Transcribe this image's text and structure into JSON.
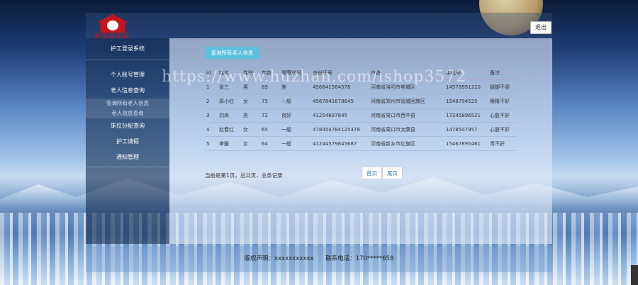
{
  "header": {
    "logo_text": "家家有家政",
    "logout_label": "退出"
  },
  "sidebar": {
    "title": "护工登录系统",
    "items": [
      {
        "label": "个人账号管理"
      },
      {
        "label": "老人信息查询"
      },
      {
        "label": "查询所有老人信息",
        "sub": true
      },
      {
        "label": "老人信息查询",
        "sub": true
      },
      {
        "label": "床位分配查询"
      },
      {
        "label": "护工请假"
      },
      {
        "label": "通知管理"
      }
    ]
  },
  "main": {
    "query_button": "查询所有老人信息",
    "columns": [
      "id",
      "姓名",
      "性别",
      "年龄",
      "健康状况",
      "身份证号",
      "户籍",
      "手机号",
      "备注"
    ],
    "rows": [
      [
        "1",
        "张三",
        "男",
        "69",
        "差",
        "456841564578",
        "河南省洛阳市老城区",
        "14578951220",
        "腿脚不便"
      ],
      [
        "2",
        "周小红",
        "女",
        "75",
        "一般",
        "4567841678645",
        "河南省郑州市管城回族区",
        "1548794525",
        "眼睛不好"
      ],
      [
        "3",
        "刘尚",
        "男",
        "72",
        "良好",
        "41254687845",
        "河南省周口市西华县",
        "17245896521",
        "心脏不好"
      ],
      [
        "4",
        "赵春红",
        "女",
        "65",
        "一般",
        "478454784125478",
        "河南省周口市太康县",
        "1478547957",
        "心脏不好"
      ],
      [
        "5",
        "李媛",
        "女",
        "64",
        "一般",
        "41244579845687",
        "河南省新乡市红旗区",
        "15467895461",
        "胃不好"
      ]
    ],
    "page_info": "当前是第1页，总共页，总条记录",
    "pager": {
      "first": "首页",
      "last": "尾页"
    }
  },
  "footer": {
    "copyright": "版权声明：xxxxxxxxxxx",
    "phone": "联系电话：170*****658"
  },
  "watermark": "https://www.huzhan.com/ishop3572"
}
